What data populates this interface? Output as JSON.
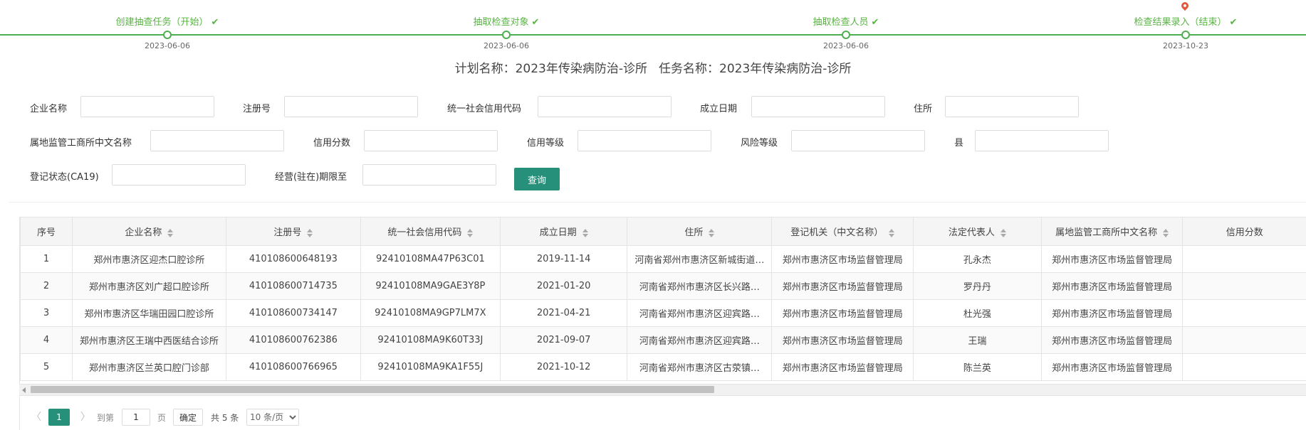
{
  "steps": [
    {
      "label": "创建抽查任务（开始）",
      "date": "2023-06-06",
      "check": "✔"
    },
    {
      "label": "抽取检查对象",
      "date": "2023-06-06",
      "check": "✔"
    },
    {
      "label": "抽取检查人员",
      "date": "2023-06-06",
      "check": "✔"
    },
    {
      "label": "检查结果录入（结束）",
      "date": "2023-10-23",
      "check": "✔"
    }
  ],
  "plan": {
    "plan_name": "计划名称：2023年传染病防治-诊所",
    "task_name": "任务名称：2023年传染病防治-诊所"
  },
  "form": {
    "fields": [
      {
        "label": "企业名称",
        "value": ""
      },
      {
        "label": "注册号",
        "value": ""
      },
      {
        "label": "统一社会信用代码",
        "value": ""
      },
      {
        "label": "成立日期",
        "value": ""
      },
      {
        "label": "住所",
        "value": ""
      },
      {
        "label": "属地监管工商所中文名称",
        "value": ""
      },
      {
        "label": "信用分数",
        "value": ""
      },
      {
        "label": "信用等级",
        "value": ""
      },
      {
        "label": "风险等级",
        "value": ""
      },
      {
        "label": "县",
        "value": ""
      },
      {
        "label": "登记状态(CA19)",
        "value": ""
      },
      {
        "label": "经营(驻在)期限至",
        "value": ""
      }
    ],
    "query_button": "查询"
  },
  "table": {
    "columns": [
      "序号",
      "企业名称",
      "注册号",
      "统一社会信用代码",
      "成立日期",
      "住所",
      "登记机关（中文名称）",
      "法定代表人",
      "属地监管工商所中文名称",
      "信用分数"
    ],
    "rows": [
      [
        "1",
        "郑州市惠济区迎杰口腔诊所",
        "410108600648193",
        "92410108MA47P63C01",
        "2019-11-14",
        "河南省郑州市惠济区新城街道…",
        "郑州市惠济区市场监督管理局",
        "孔永杰",
        "郑州市惠济区市场监督管理局",
        ""
      ],
      [
        "2",
        "郑州市惠济区刘广超口腔诊所",
        "410108600714735",
        "92410108MA9GAE3Y8P",
        "2021-01-20",
        "河南省郑州市惠济区长兴路…",
        "郑州市惠济区市场监督管理局",
        "罗丹丹",
        "郑州市惠济区市场监督管理局",
        ""
      ],
      [
        "3",
        "郑州市惠济区华瑞田园口腔诊所",
        "410108600734147",
        "92410108MA9GP7LM7X",
        "2021-04-21",
        "河南省郑州市惠济区迎宾路…",
        "郑州市惠济区市场监督管理局",
        "杜光强",
        "郑州市惠济区市场监督管理局",
        ""
      ],
      [
        "4",
        "郑州市惠济区王瑞中西医结合诊所",
        "410108600762386",
        "92410108MA9K60T33J",
        "2021-09-07",
        "河南省郑州市惠济区迎宾路…",
        "郑州市惠济区市场监督管理局",
        "王瑞",
        "郑州市惠济区市场监督管理局",
        ""
      ],
      [
        "5",
        "郑州市惠济区兰英口腔门诊部",
        "410108600766965",
        "92410108MA9KA1F55J",
        "2021-10-12",
        "河南省郑州市惠济区古荥镇…",
        "郑州市惠济区市场监督管理局",
        "陈兰英",
        "郑州市惠济区市场监督管理局",
        ""
      ]
    ]
  },
  "pagination": {
    "prev": "〈",
    "current_page": "1",
    "next": "〉",
    "goto_label": "到第",
    "goto_value": "1",
    "page_unit": "页",
    "confirm": "确定",
    "total": "共 5 条",
    "page_size": "10 条/页"
  },
  "colors": {
    "accent": "#27907a",
    "step_green": "#58b442",
    "marker_red": "#e2583e"
  }
}
